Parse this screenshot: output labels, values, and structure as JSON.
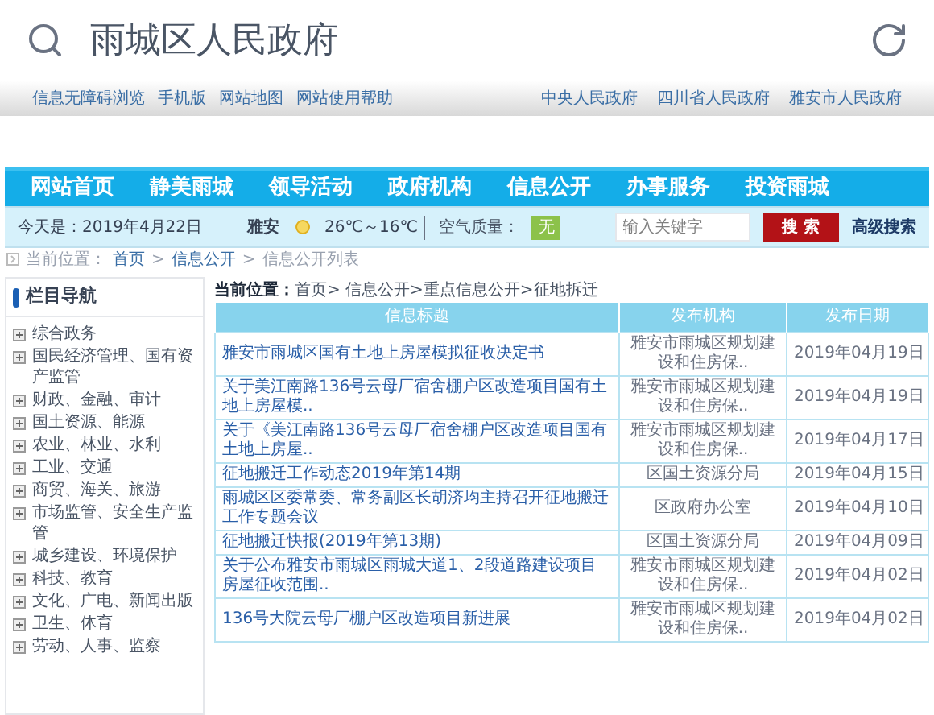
{
  "browser": {
    "title": "雨城区人民政府"
  },
  "top_links": {
    "left": [
      "信息无障碍浏览",
      "手机版",
      "网站地图",
      "网站使用帮助"
    ],
    "right": [
      "中央人民政府",
      "四川省人民政府",
      "雅安市人民政府"
    ]
  },
  "nav": [
    "网站首页",
    "静美雨城",
    "领导活动",
    "政府机构",
    "信息公开",
    "办事服务",
    "投资雨城"
  ],
  "info_bar": {
    "date_label": "今天是：",
    "date": "2019年4月22日",
    "city": "雅安",
    "temperature": "26℃～16℃",
    "air_label": "空气质量：",
    "air_value": "无",
    "search_placeholder": "输入关键字",
    "search_button": "搜 索",
    "advanced": "高级搜索"
  },
  "breadcrumb": {
    "label": "当前位置：",
    "separator": ">",
    "items": [
      "首页",
      "信息公开",
      "信息公开列表"
    ]
  },
  "sidebar": {
    "title": "栏目导航",
    "items": [
      "综合政务",
      "国民经济管理、国有资产监管",
      "财政、金融、审计",
      "国土资源、能源",
      "农业、林业、水利",
      "工业、交通",
      "商贸、海关、旅游",
      "市场监管、安全生产监管",
      "城乡建设、环境保护",
      "科技、教育",
      "文化、广电、新闻出版",
      "卫生、体育",
      "劳动、人事、监察"
    ]
  },
  "location": {
    "label": "当前位置：",
    "path": "首页> 信息公开>重点信息公开>征地拆迁"
  },
  "table": {
    "columns": [
      "信息标题",
      "发布机构",
      "发布日期"
    ],
    "rows": [
      [
        "雅安市雨城区国有土地上房屋模拟征收决定书",
        "雅安市雨城区规划建设和住房保..",
        "2019年04月19日"
      ],
      [
        "关于美江南路136号云母厂宿舍棚户区改造项目国有土地上房屋模..",
        "雅安市雨城区规划建设和住房保..",
        "2019年04月19日"
      ],
      [
        "关于《美江南路136号云母厂宿舍棚户区改造项目国有土地上房屋..",
        "雅安市雨城区规划建设和住房保..",
        "2019年04月17日"
      ],
      [
        "征地搬迁工作动态2019年第14期",
        "区国土资源分局",
        "2019年04月15日"
      ],
      [
        "雨城区区委常委、常务副区长胡济均主持召开征地搬迁工作专题会议",
        "区政府办公室",
        "2019年04月10日"
      ],
      [
        "征地搬迁快报(2019年第13期)",
        "区国土资源分局",
        "2019年04月09日"
      ],
      [
        "关于公布雅安市雨城区雨城大道1、2段道路建设项目房屋征收范围..",
        "雅安市雨城区规划建设和住房保..",
        "2019年04月02日"
      ],
      [
        "136号大院云母厂棚户区改造项目新进展",
        "雅安市雨城区规划建设和住房保..",
        "2019年04月02日"
      ]
    ]
  }
}
